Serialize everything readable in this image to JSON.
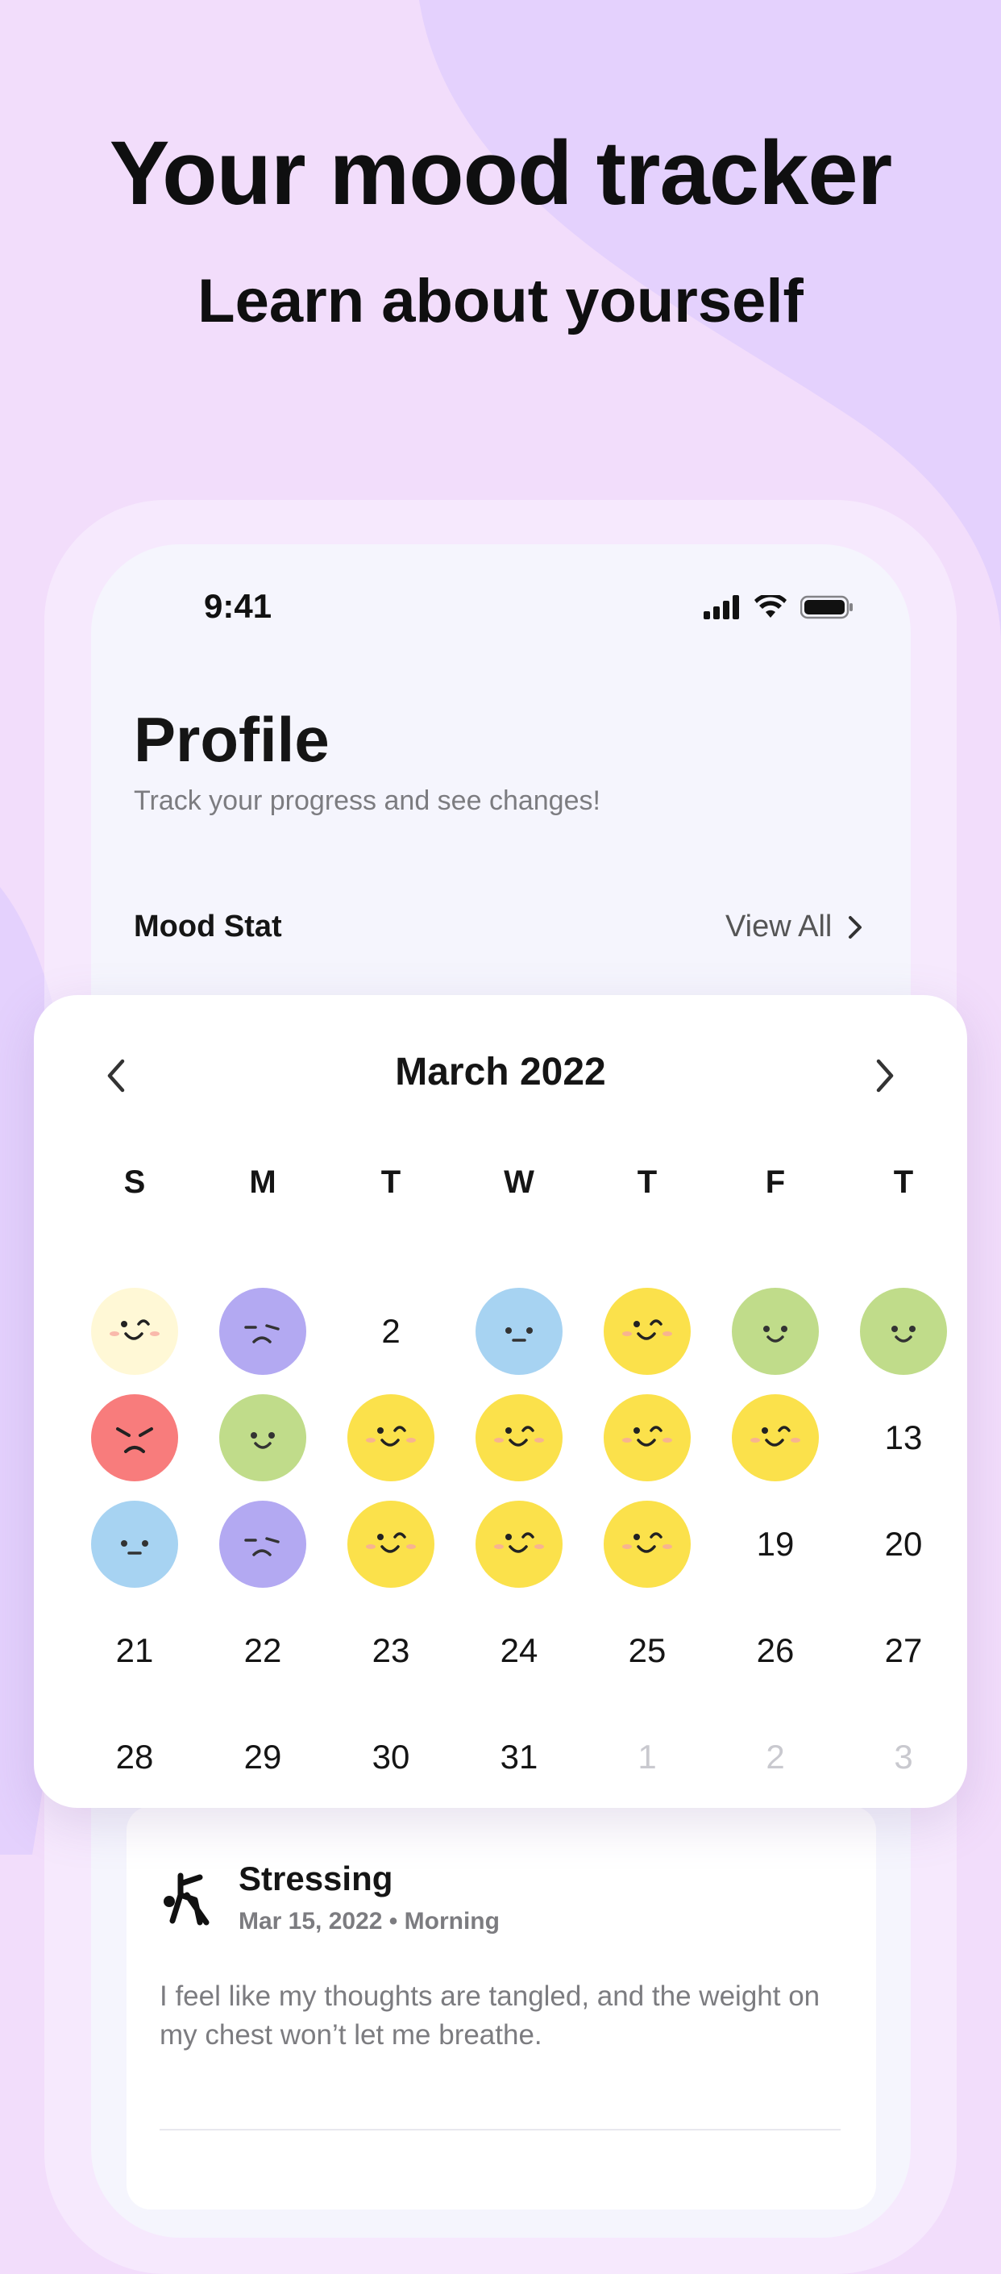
{
  "headline": "Your mood tracker",
  "subheadline": "Learn about yourself",
  "status_bar": {
    "time": "9:41"
  },
  "profile": {
    "title": "Profile",
    "subtitle": "Track your progress and see changes!",
    "section_title": "Mood Stat",
    "view_all_label": "View All"
  },
  "calendar": {
    "month_label": "March 2022",
    "weekdays": [
      "S",
      "M",
      "T",
      "W",
      "T",
      "F",
      "T"
    ],
    "days": [
      {
        "label": "1",
        "mood": "happy",
        "color": "#fff8d6"
      },
      {
        "label": "2",
        "mood": "sad",
        "color": "#b3a9f2"
      },
      {
        "label": "2",
        "mood": ""
      },
      {
        "label": "3",
        "mood": "calm",
        "color": "#a7d3f2"
      },
      {
        "label": "4",
        "mood": "happy",
        "color": "#fbe14b"
      },
      {
        "label": "5",
        "mood": "content",
        "color": "#c0dc8a"
      },
      {
        "label": "6",
        "mood": "content",
        "color": "#c0dc8a"
      },
      {
        "label": "7",
        "mood": "angry",
        "color": "#f87c7c"
      },
      {
        "label": "8",
        "mood": "content",
        "color": "#c0dc8a"
      },
      {
        "label": "9",
        "mood": "happy",
        "color": "#fbe14b"
      },
      {
        "label": "10",
        "mood": "happy",
        "color": "#fbe14b"
      },
      {
        "label": "11",
        "mood": "happy",
        "color": "#fbe14b"
      },
      {
        "label": "12",
        "mood": "happy",
        "color": "#fbe14b"
      },
      {
        "label": "13",
        "mood": ""
      },
      {
        "label": "14",
        "mood": "calm",
        "color": "#a7d3f2"
      },
      {
        "label": "15",
        "mood": "sad",
        "color": "#b3a9f2"
      },
      {
        "label": "16",
        "mood": "happy",
        "color": "#fbe14b"
      },
      {
        "label": "17",
        "mood": "happy",
        "color": "#fbe14b"
      },
      {
        "label": "18",
        "mood": "happy",
        "color": "#fbe14b"
      },
      {
        "label": "19",
        "mood": ""
      },
      {
        "label": "20",
        "mood": ""
      },
      {
        "label": "21",
        "mood": ""
      },
      {
        "label": "22",
        "mood": ""
      },
      {
        "label": "23",
        "mood": ""
      },
      {
        "label": "24",
        "mood": ""
      },
      {
        "label": "25",
        "mood": ""
      },
      {
        "label": "26",
        "mood": ""
      },
      {
        "label": "27",
        "mood": ""
      },
      {
        "label": "28",
        "mood": ""
      },
      {
        "label": "29",
        "mood": ""
      },
      {
        "label": "30",
        "mood": ""
      },
      {
        "label": "31",
        "mood": ""
      },
      {
        "label": "1",
        "mood": "",
        "muted": true
      },
      {
        "label": "2",
        "mood": "",
        "muted": true
      },
      {
        "label": "3",
        "mood": "",
        "muted": true
      }
    ]
  },
  "entry": {
    "title": "Stressing",
    "meta": "Mar 15, 2022 • Morning",
    "text": "I feel like my thoughts are tangled, and the weight on my chest won’t let me breathe.",
    "icon": "stressing-figure-icon"
  }
}
